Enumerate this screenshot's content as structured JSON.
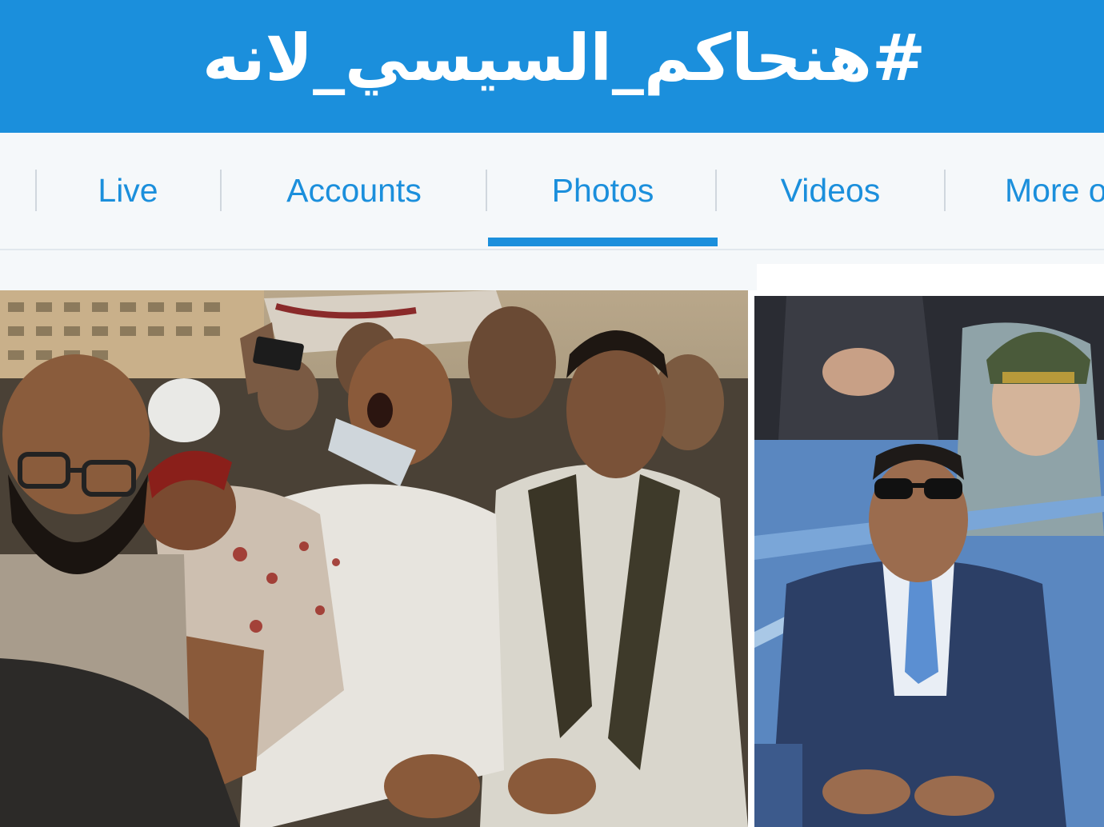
{
  "header": {
    "hashtag": "#هنحاكم_السيسي_لانه"
  },
  "tabs": [
    {
      "label": "Live"
    },
    {
      "label": "Accounts"
    },
    {
      "label": "Photos",
      "active": true
    },
    {
      "label": "Videos"
    },
    {
      "label": "More o"
    }
  ],
  "colors": {
    "brand_blue": "#1b8fdc",
    "tabbar_bg": "#f5f8fa"
  },
  "photos": [
    {
      "name": "protest-crowd-photo"
    },
    {
      "name": "official-in-sunglasses-photo"
    }
  ]
}
